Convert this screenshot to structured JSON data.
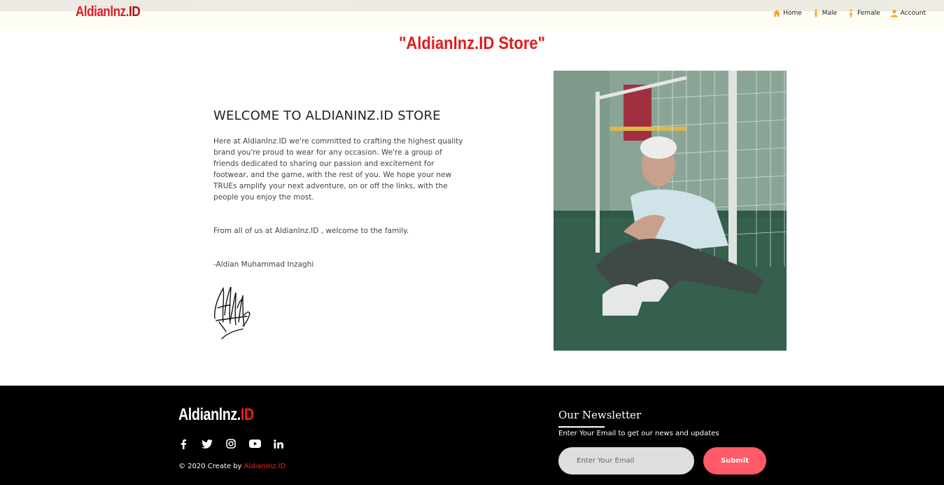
{
  "nav": {
    "brand_part1": "Aldianlnz.",
    "brand_part2": "ID",
    "links": [
      {
        "label": "Home",
        "icon": "home-icon"
      },
      {
        "label": "Male",
        "icon": "male-icon"
      },
      {
        "label": "Female",
        "icon": "female-icon"
      },
      {
        "label": "Account",
        "icon": "user-icon"
      }
    ]
  },
  "page_title": "\"Aldianlnz.ID Store\"",
  "welcome": {
    "heading": "WELCOME TO ALDIANINZ.ID STORE",
    "paragraph1": "Here at AldianInz.ID we're committed to crafting the highest quality brand you're proud to wear for any occasion. We're a group of friends dedicated to sharing our passion and excitement for footwear, and the game, with the rest of you. We hope your new TRUEs amplify your next adventure, on or off the links, with the people you enjoy the most.",
    "paragraph2": "From all of us at AldianInz.ID , welcome to the family.",
    "signoff": "-Aldian Muhammad Inzaghi"
  },
  "footer": {
    "brand_white": "Aldianlnz.",
    "brand_red": "ID",
    "socials": [
      "facebook-icon",
      "twitter-icon",
      "instagram-icon",
      "youtube-icon",
      "linkedin-icon"
    ],
    "copyright_prefix": "© 2020 Create by ",
    "copyright_brand": "AldianInz.ID",
    "newsletter_title": "Our Newsletter",
    "newsletter_sub": "Enter Your Email to get our news and updates",
    "email_placeholder": "Enter Your Email",
    "submit_label": "Submit"
  },
  "colors": {
    "accent_red": "#e31b23",
    "submit_pink": "#ff5a66",
    "icon_orange": "#f5a623"
  }
}
